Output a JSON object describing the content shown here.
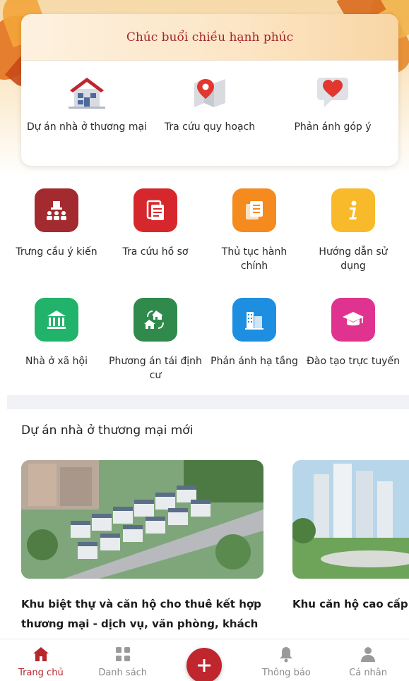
{
  "greeting": "Chúc buổi chiều hạnh phúc",
  "quick_access": [
    {
      "label": "Dự án nhà ở thương mại",
      "icon": "house-icon"
    },
    {
      "label": "Tra cứu quy hoạch",
      "icon": "map-pin-icon"
    },
    {
      "label": "Phản ánh góp ý",
      "icon": "heart-chat-icon"
    }
  ],
  "services": [
    {
      "label": "Trưng cầu ý kiến",
      "icon": "poll-people-icon",
      "color": "#a32a2e"
    },
    {
      "label": "Tra cứu hồ sơ",
      "icon": "document-icon",
      "color": "#d6282c"
    },
    {
      "label": "Thủ tục hành chính",
      "icon": "copy-documents-icon",
      "color": "#f58a1f"
    },
    {
      "label": "Hướng dẫn sử dụng",
      "icon": "info-icon",
      "color": "#f8b92a"
    },
    {
      "label": "Nhà ở xã hội",
      "icon": "building-columns-icon",
      "color": "#22b36b"
    },
    {
      "label": "Phương án tái định cư",
      "icon": "house-exchange-icon",
      "color": "#2f8a4c"
    },
    {
      "label": "Phản ánh hạ tầng",
      "icon": "city-buildings-icon",
      "color": "#1e8fe0"
    },
    {
      "label": "Đào tạo trực tuyến",
      "icon": "graduation-cap-icon",
      "color": "#e0338f"
    }
  ],
  "section_title": "Dự án nhà ở thương mại mới",
  "projects": [
    {
      "title": "Khu biệt thự và căn hộ cho thuê kết hợp thương mại - dịch vụ, văn phòng, khách sạn"
    },
    {
      "title": "Khu căn hộ cao cấp"
    }
  ],
  "nav": {
    "home": "Trang chủ",
    "list": "Danh sách",
    "notifications": "Thông báo",
    "profile": "Cá nhân"
  },
  "colors": {
    "accent": "#c0262d",
    "nav_inactive": "#8a8a8a"
  }
}
